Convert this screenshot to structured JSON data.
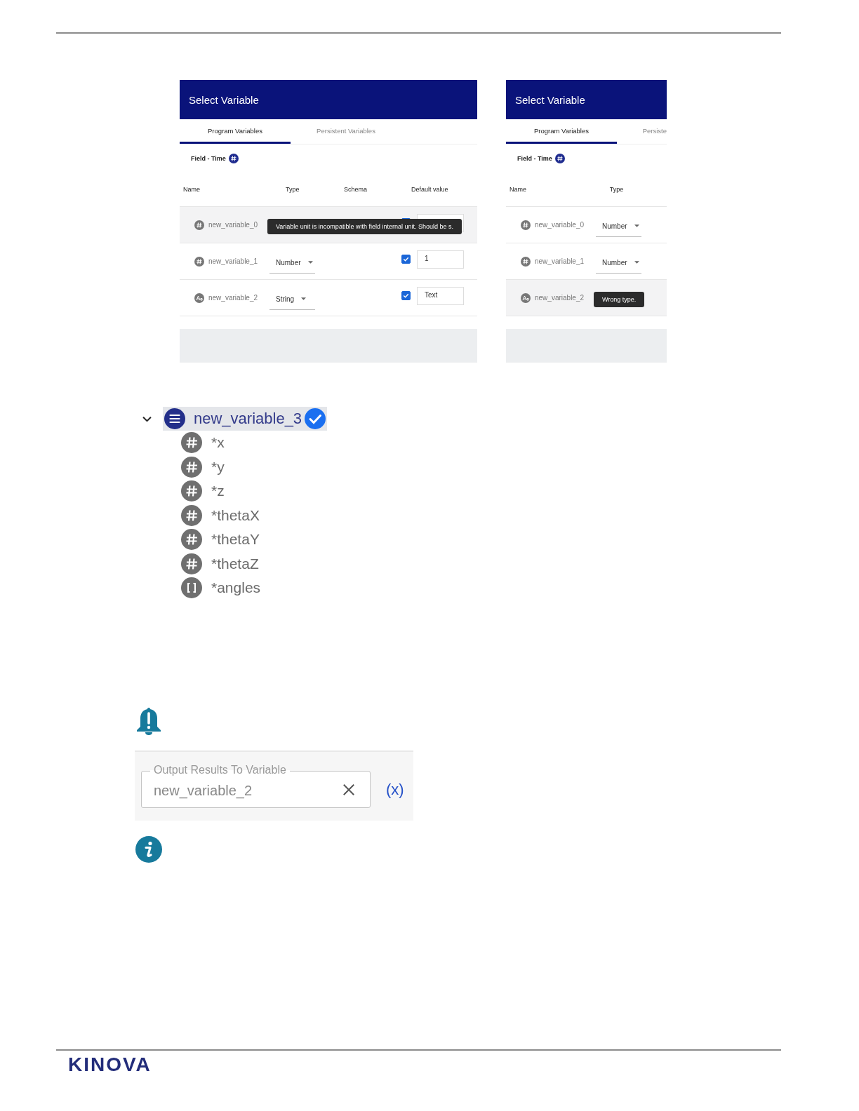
{
  "screenshots": [
    {
      "title": "Select Variable",
      "tabs": [
        {
          "label": "Program Variables",
          "selected": true
        },
        {
          "label": "Persistent Variables",
          "selected": false
        }
      ],
      "field_label": "Field - Time",
      "columns": [
        "Name",
        "Type",
        "Schema",
        "Default value"
      ],
      "rows": [
        {
          "name": "new_variable_0",
          "kind": "number",
          "highlighted": true,
          "checked": true,
          "default_value": "",
          "tooltip": "Variable unit is incompatible with field internal unit. Should be s."
        },
        {
          "name": "new_variable_1",
          "kind": "number",
          "highlighted": false,
          "type": "Number",
          "checked": true,
          "default_value": "1"
        },
        {
          "name": "new_variable_2",
          "kind": "text",
          "highlighted": false,
          "type": "String",
          "checked": true,
          "default_value": "Text"
        }
      ]
    },
    {
      "title": "Select Variable",
      "tabs": [
        {
          "label": "Program Variables",
          "selected": true
        },
        {
          "label": "Persiste",
          "selected": false
        }
      ],
      "field_label": "Field - Time",
      "columns": [
        "Name",
        "Type"
      ],
      "rows": [
        {
          "name": "new_variable_0",
          "kind": "number",
          "highlighted": false,
          "type": "Number"
        },
        {
          "name": "new_variable_1",
          "kind": "number",
          "highlighted": false,
          "type": "Number"
        },
        {
          "name": "new_variable_2",
          "kind": "text",
          "highlighted": true,
          "tooltip": "Wrong type."
        }
      ]
    }
  ],
  "tree": {
    "label": "new_variable_3",
    "expanded": true,
    "selected": true,
    "children": [
      {
        "label": "*x",
        "kind": "number"
      },
      {
        "label": "*y",
        "kind": "number"
      },
      {
        "label": "*z",
        "kind": "number"
      },
      {
        "label": "*thetaX",
        "kind": "number"
      },
      {
        "label": "*thetaY",
        "kind": "number"
      },
      {
        "label": "*thetaZ",
        "kind": "number"
      },
      {
        "label": "*angles",
        "kind": "array"
      }
    ]
  },
  "output_field": {
    "label": "Output Results To Variable",
    "value": "new_variable_2",
    "variable_button": "(x)"
  },
  "logo": "KINOVA"
}
